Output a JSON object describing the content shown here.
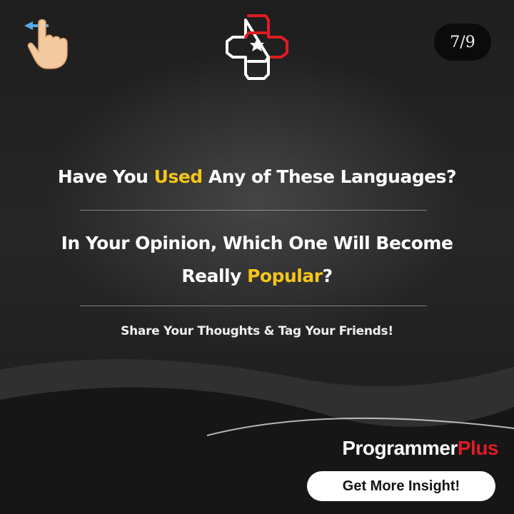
{
  "header": {
    "swipe_icon": "swipe-left-hand-icon",
    "logo": "programmer-plus-logo",
    "counter": "7/9"
  },
  "main": {
    "question_pre": "Have You ",
    "question_highlight": "Used",
    "question_post": " Any of These Languages?",
    "prompt_line1": "In Your Opinion, Which One Will Become",
    "prompt_pre": "Really ",
    "prompt_highlight": "Popular",
    "prompt_post": "?",
    "cta": "Share Your Thoughts & Tag Your Friends!"
  },
  "footer": {
    "brand_main": "Programmer",
    "brand_accent": "Plus",
    "button_label": "Get More Insight!"
  },
  "colors": {
    "highlight": "#f5c518",
    "brand_red": "#e01b24",
    "background": "#1e1e1e"
  }
}
